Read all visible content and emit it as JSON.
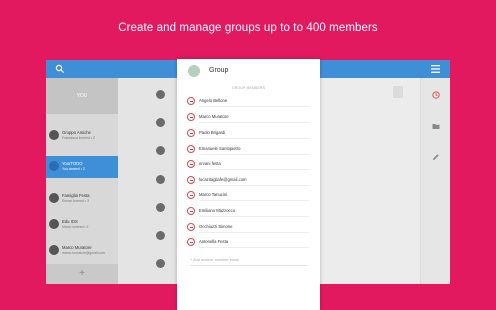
{
  "headline": "Create and manage groups up to to 400 members",
  "colors": {
    "background": "#e2195f",
    "appbar": "#3f8fd8",
    "remove": "#e04848"
  },
  "sidebar": {
    "you_label": "YOU",
    "items": [
      {
        "name": "Gruppo Amiche",
        "sub": "Francesca lovered • 2"
      },
      {
        "name": "YourTODO",
        "sub": "You cleared • 2"
      },
      {
        "name": "Famiglia Festa",
        "sub": "Erman lovered • 3"
      },
      {
        "name": "Edu IOS",
        "sub": "Marco lovered • 2"
      },
      {
        "name": "Marco Muratore",
        "sub": "marco.muratore@gmail.com"
      },
      {
        "name": "Tono Loi",
        "sub": ""
      }
    ],
    "add_glyph": "+"
  },
  "dialog": {
    "group_name": "Group",
    "section_label": "GROUP MEMBERS",
    "members": [
      "Angelo Bellone",
      "Marco Muratore",
      "Paolo Brigardi",
      "Emanuele Santopietro",
      "ervani festa",
      "lucazitagliafe@gmail.com",
      "Marco Tanucini",
      "Emiliano Mazzocco",
      "Occhiuzzi Simone",
      "Antonella Festa"
    ],
    "add_placeholder": "+ Add another member email"
  },
  "icons": [
    "search-icon",
    "menu-icon",
    "clock-icon",
    "folder-icon",
    "pencil-icon",
    "remove-member-icon",
    "group-avatar-icon"
  ]
}
